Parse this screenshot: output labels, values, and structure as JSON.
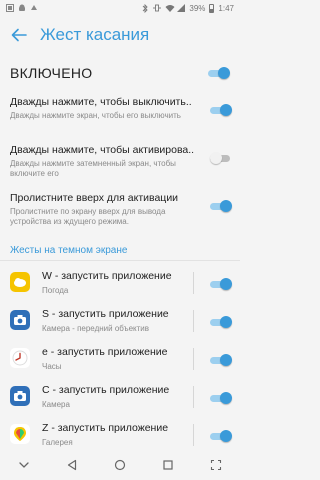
{
  "status_bar": {
    "battery": "39%",
    "time": "1:47",
    "left_icons": [
      "notification-icon",
      "android-icon",
      "sync-icon"
    ],
    "right_icons": [
      "bluetooth-icon",
      "vibrate-icon",
      "wifi-icon",
      "signal-icon"
    ]
  },
  "header": {
    "title": "Жест касания"
  },
  "master": {
    "label": "ВКЛЮЧЕНО",
    "on": true
  },
  "settings": [
    {
      "title": "Дважды нажмите, чтобы выключить..",
      "desc": "Дважды нажмите экран, чтобы его выключить",
      "on": true
    },
    {
      "title": "Дважды нажмите, чтобы активирова..",
      "desc": "Дважды нажмите затемненный экран, чтобы включите его",
      "on": false
    },
    {
      "title": "Пролистните вверх для активации",
      "desc": "Пролистните по экрану вверх для вывода устройства из ждущего режима.",
      "on": true
    }
  ],
  "section": {
    "title": "Жесты на темном экране"
  },
  "gestures": [
    {
      "title": "W - запустить приложение",
      "sub": "Погода",
      "icon": "weather-app-icon",
      "color": "#f5c400",
      "on": true
    },
    {
      "title": "S - запустить приложение",
      "sub": "Камера - передний объектив",
      "icon": "front-camera-app-icon",
      "color": "#2f6fb8",
      "on": true
    },
    {
      "title": "e - запустить приложение",
      "sub": "Часы",
      "icon": "clock-app-icon",
      "color": "#ffffff",
      "on": true
    },
    {
      "title": "C - запустить приложение",
      "sub": "Камера",
      "icon": "camera-app-icon",
      "color": "#2f6fb8",
      "on": true
    },
    {
      "title": "Z - запустить приложение",
      "sub": "Галерея",
      "icon": "gallery-app-icon",
      "color": "#ffffff",
      "on": true
    }
  ],
  "colors": {
    "accent": "#3a9ad9",
    "track_on": "#9ccfef",
    "background": "#f4f4f4"
  },
  "nav_icons": [
    "hide-navbar-icon",
    "back-nav-icon",
    "home-nav-icon",
    "recents-nav-icon",
    "screenshot-nav-icon"
  ]
}
